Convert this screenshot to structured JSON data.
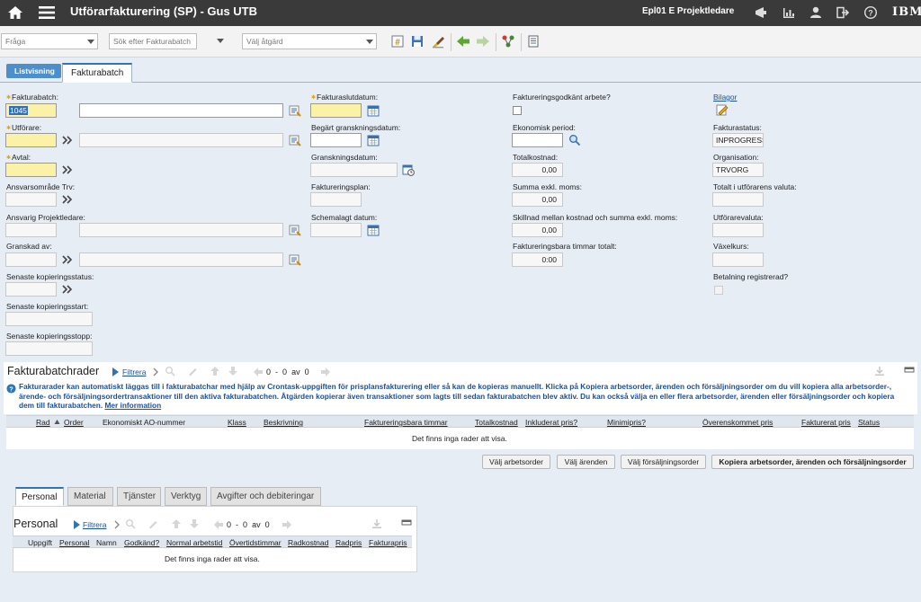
{
  "app": {
    "title": "Utförarfakturering (SP) - Gus UTB",
    "user": "Epl01 E Projektledare",
    "brand": "IBM"
  },
  "toolbar": {
    "query_placeholder": "Fråga",
    "search_placeholder": "Sök efter Fakturabatch",
    "action_placeholder": "Välj åtgärd"
  },
  "tabs": {
    "list_view": "Listvisning",
    "main": "Fakturabatch"
  },
  "form": {
    "fakturabatch_label": "Fakturabatch:",
    "fakturabatch_value": "1045",
    "fakturabatch_desc": "",
    "utforare_label": "Utförare:",
    "avtal_label": "Avtal:",
    "ansvarsomrade_label": "Ansvarsområde Trv:",
    "ansvarig_label": "Ansvarig Projektledare:",
    "granskad_label": "Granskad av:",
    "senaste_status_label": "Senaste kopieringsstatus:",
    "senaste_start_label": "Senaste kopieringsstart:",
    "senaste_stopp_label": "Senaste kopieringsstopp:",
    "fakturaslutdatum_label": "Fakturaslutdatum:",
    "begart_label": "Begärt granskningsdatum:",
    "granskningsdatum_label": "Granskningsdatum:",
    "faktureringsplan_label": "Faktureringsplan:",
    "schemalagt_label": "Schemalagt datum:",
    "godkant_label": "Faktureringsgodkänt arbete?",
    "ekonomisk_label": "Ekonomisk period:",
    "totalkostnad_label": "Totalkostnad:",
    "totalkostnad_value": "0,00",
    "summa_label": "Summa exkl. moms:",
    "summa_value": "0,00",
    "skillnad_label": "Skillnad mellan kostnad och summa exkl. moms:",
    "skillnad_value": "0,00",
    "timmar_label": "Faktureringsbara timmar totalt:",
    "timmar_value": "0:00",
    "bilagor_label": "Bilagor",
    "fakturastatus_label": "Fakturastatus:",
    "fakturastatus_value": "INPROGRESS",
    "organisation_label": "Organisation:",
    "organisation_value": "TRVORG",
    "totalt_valuta_label": "Totalt i utförarens valuta:",
    "utforarevaluta_label": "Utförarevaluta:",
    "vaxelkurs_label": "Växelkurs:",
    "betalning_label": "Betalning registrerad?"
  },
  "batchrows": {
    "title": "Fakturabatchrader",
    "filter": "Filtrera",
    "pager_from": "0",
    "pager_dash": "-",
    "pager_to": "0",
    "pager_of": "av",
    "pager_total": "0",
    "info": "Fakturarader kan automatiskt läggas till i fakturabatchar med hjälp av Crontask-uppgiften för prisplansfakturering eller så kan de kopieras manuellt. Klicka på Kopiera arbetsorder, ärenden och försäljningsorder om du vill kopiera alla arbetsorder-, ärende- och försäljningsordertransaktioner till den aktiva fakturabatchen. Åtgärden kopierar även transaktioner som lagts till sedan fakturabatchen blev aktiv. Du kan också välja en eller flera arbetsorder, ärenden eller försäljningsorder och kopiera dem till fakturabatchen.",
    "info_more": "Mer information",
    "columns": [
      "Rad",
      "Order",
      "Ekonomiskt AO-nummer",
      "Klass",
      "Beskrivning",
      "Faktureringsbara timmar",
      "Totalkostnad",
      "Inkluderat pris?",
      "Minimipris?",
      "Överenskommet pris",
      "Fakturerat pris",
      "Status"
    ],
    "no_rows": "Det finns inga rader att visa.",
    "btn_work_orders": "Välj arbetsorder",
    "btn_tickets": "Välj ärenden",
    "btn_sales": "Välj försäljningsorder",
    "btn_copy": "Kopiera arbetsorder, ärenden och försäljningsorder"
  },
  "subtabs": [
    "Personal",
    "Material",
    "Tjänster",
    "Verktyg",
    "Avgifter och debiteringar"
  ],
  "personal": {
    "title": "Personal",
    "filter": "Filtrera",
    "pager_from": "0",
    "pager_dash": "-",
    "pager_to": "0",
    "pager_of": "av",
    "pager_total": "0",
    "columns": [
      "Uppgift",
      "Personal",
      "Namn",
      "Godkänd?",
      "Normal arbetstid",
      "Övertidstimmar",
      "Radkostnad",
      "Radpris",
      "Fakturapris"
    ],
    "no_rows": "Det finns inga rader att visa."
  },
  "colors": {
    "topbar": "#3a3a3a",
    "accent": "#2e75b6",
    "required_field": "#fbf2a8",
    "work_area": "#e6edf5",
    "link": "#1a4f9a"
  }
}
